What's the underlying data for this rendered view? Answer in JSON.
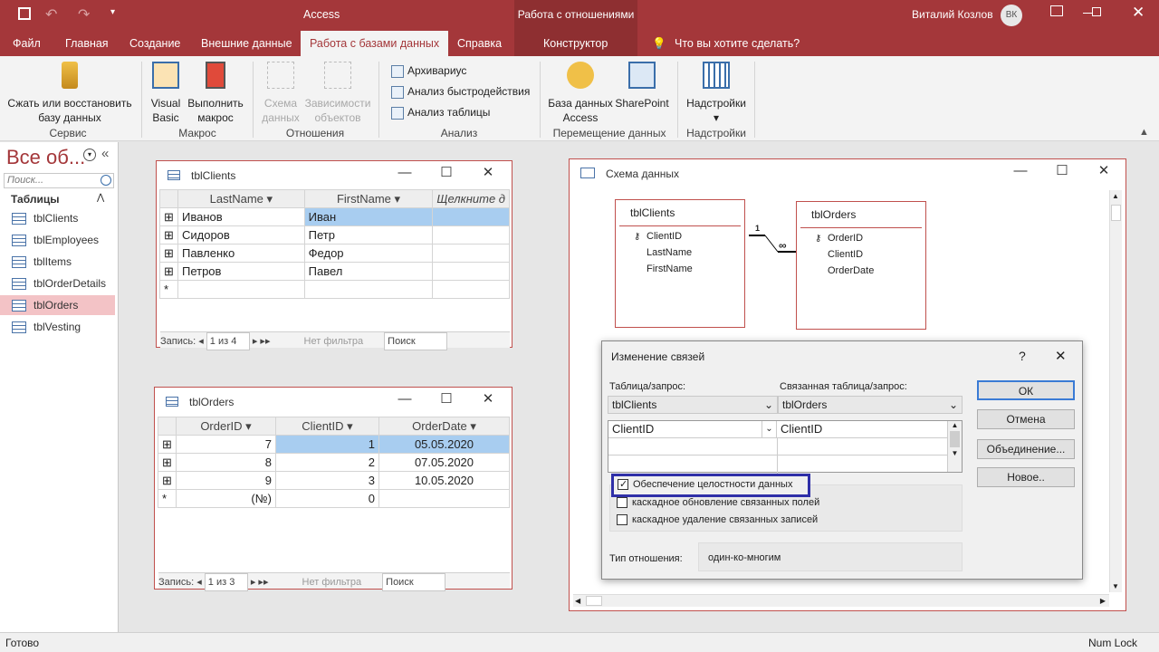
{
  "title": {
    "app": "Access",
    "context": "Работа с отношениями",
    "user": "Виталий Козлов",
    "initials": "ВК"
  },
  "tabs": [
    "Файл",
    "Главная",
    "Создание",
    "Внешние данные",
    "Работа с базами данных",
    "Справка",
    "Конструктор"
  ],
  "tellme": "Что вы хотите сделать?",
  "ribbon": {
    "compact": "Сжать или восстановить базу данных",
    "vb": "Visual Basic",
    "macro": "Выполнить макрос",
    "schema": "Схема данных",
    "deps": "Зависимости объектов",
    "documenter": "Архивариус",
    "perf": "Анализ быстродействия",
    "tableanalyze": "Анализ таблицы",
    "dbaccess": "База данных Access",
    "sharepoint": "SharePoint",
    "addins": "Надстройки",
    "groups": {
      "service": "Сервис",
      "macro": "Макрос",
      "relations": "Отношения",
      "analysis": "Анализ",
      "move": "Перемещение данных",
      "addins": "Надстройки"
    }
  },
  "nav": {
    "title": "Все об...",
    "search": "Поиск...",
    "section": "Таблицы",
    "items": [
      "tblClients",
      "tblEmployees",
      "tblItems",
      "tblOrderDetails",
      "tblOrders",
      "tblVesting"
    ],
    "selected": "tblOrders"
  },
  "clients": {
    "title": "tblClients",
    "cols": [
      "LastName",
      "FirstName",
      "Щелкните д"
    ],
    "rows": [
      [
        "Иванов",
        "Иван"
      ],
      [
        "Сидоров",
        "Петр"
      ],
      [
        "Павленко",
        "Федор"
      ],
      [
        "Петров",
        "Павел"
      ]
    ],
    "record_label": "Запись:",
    "record_pos": "1 из 4",
    "filter": "Нет фильтра",
    "search": "Поиск"
  },
  "orders": {
    "title": "tblOrders",
    "cols": [
      "OrderID",
      "ClientID",
      "OrderDate"
    ],
    "rows": [
      [
        "7",
        "1",
        "05.05.2020"
      ],
      [
        "8",
        "2",
        "07.05.2020"
      ],
      [
        "9",
        "3",
        "10.05.2020"
      ]
    ],
    "newrow": [
      "(№)",
      "0"
    ],
    "record_label": "Запись:",
    "record_pos": "1 из 3",
    "filter": "Нет фильтра",
    "search": "Поиск"
  },
  "schema": {
    "title": "Схема данных",
    "t1": {
      "name": "tblClients",
      "fields": [
        "ClientID",
        "LastName",
        "FirstName"
      ]
    },
    "t2": {
      "name": "tblOrders",
      "fields": [
        "OrderID",
        "ClientID",
        "OrderDate"
      ]
    },
    "one": "1",
    "many": "∞"
  },
  "dialog": {
    "title": "Изменение связей",
    "help": "?",
    "table_label": "Таблица/запрос:",
    "related_label": "Связанная таблица/запрос:",
    "table": "tblClients",
    "related": "tblOrders",
    "field1": "ClientID",
    "field2": "ClientID",
    "integrity": "Обеспечение целостности данных",
    "cascade_update": "каскадное обновление связанных полей",
    "cascade_delete": "каскадное удаление связанных записей",
    "reltype_label": "Тип отношения:",
    "reltype": "один-ко-многим",
    "ok": "ОК",
    "cancel": "Отмена",
    "join": "Объединение...",
    "new": "Новое.."
  },
  "status": {
    "left": "Готово",
    "right": "Num Lock"
  }
}
